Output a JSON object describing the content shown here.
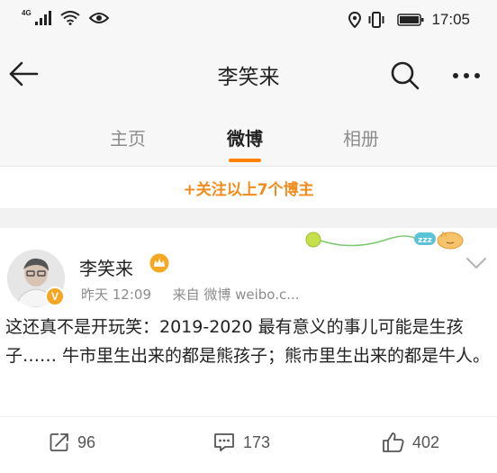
{
  "status_bar": {
    "network": "4G",
    "time": "17:05"
  },
  "header": {
    "title": "李笑来"
  },
  "tabs": [
    {
      "label": "主页",
      "active": false
    },
    {
      "label": "微博",
      "active": true
    },
    {
      "label": "相册",
      "active": false
    }
  ],
  "follow_prompt": "+关注以上7个博主",
  "post": {
    "author": "李笑来",
    "time": "昨天 12:09",
    "source": "来自 微博 weibo.c...",
    "text": "这还真不是开玩笑：2019-2020 最有意义的事儿可能是生孩子…… 牛市里生出来的都是熊孩子；熊市里生出来的都是牛人。",
    "actions": {
      "reposts": "96",
      "comments": "173",
      "likes": "402"
    }
  },
  "colors": {
    "accent": "#ff8200",
    "follow": "#f08b1c",
    "verified": "#f5a623"
  }
}
